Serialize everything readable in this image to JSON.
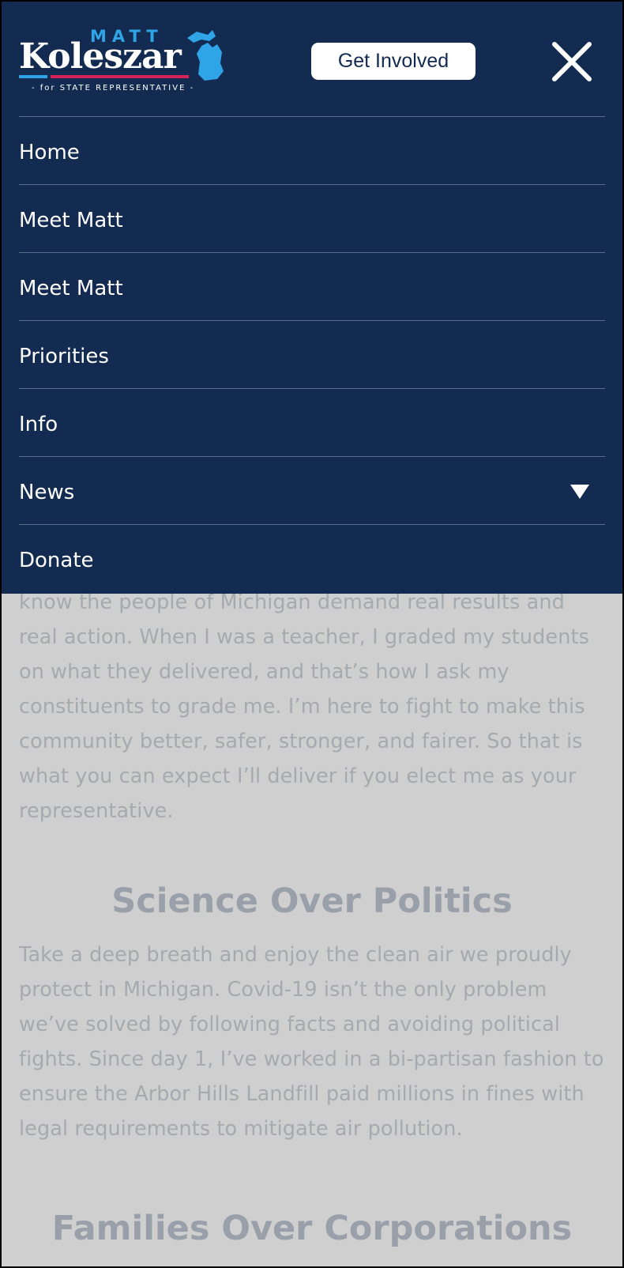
{
  "logo": {
    "first_name": "MATT",
    "last_name": "Koleszar",
    "tagline": "- for STATE REPRESENTATIVE -"
  },
  "header": {
    "cta_label": "Get Involved"
  },
  "nav": {
    "items": [
      {
        "label": "Home"
      },
      {
        "label": "Meet Matt"
      },
      {
        "label": "Meet Matt"
      },
      {
        "label": "Priorities"
      },
      {
        "label": "Info"
      },
      {
        "label": "News",
        "has_dropdown": true
      },
      {
        "label": "Donate"
      }
    ]
  },
  "background": {
    "paragraph1": "know the people of Michigan demand real results and real action. When I was a teacher, I graded my students on what they delivered, and that’s how I ask my constituents to grade me. I’m here to fight to make this community better, safer, stronger, and fairer. So that is what you can expect I’ll deliver if you elect me as your representative.",
    "heading1": "Science Over Politics",
    "paragraph2": "Take a deep breath and enjoy the clean air we proudly protect in Michigan. Covid-19 isn’t the only problem we’ve solved by following facts and avoiding political fights. Since day 1, I’ve worked in a bi-partisan fashion to ensure the Arbor Hills Landfill paid millions in fines with legal requirements to mitigate air pollution.",
    "heading2": "Families Over Corporations"
  },
  "colors": {
    "menu_bg": "#132b50",
    "accent_blue": "#2fa4e7",
    "accent_red": "#d8235a",
    "page_bg": "#cfcfcf"
  }
}
